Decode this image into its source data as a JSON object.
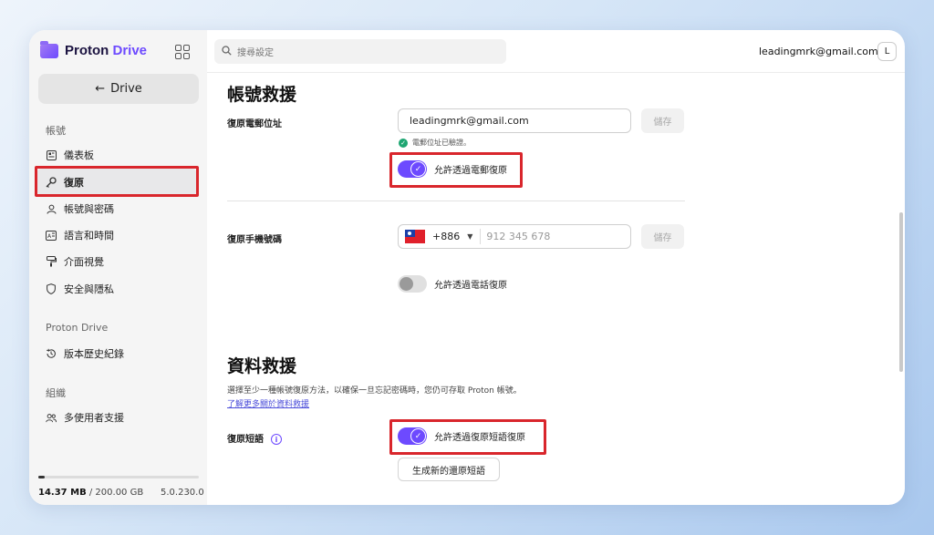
{
  "app": {
    "name_part1": "Proton",
    "name_part2": "Drive"
  },
  "sidebar": {
    "back_label": "Drive",
    "sections": [
      {
        "title": "帳號",
        "items": [
          "儀表板",
          "復原",
          "帳號與密碼",
          "語言和時間",
          "介面視覺",
          "安全與隱私"
        ]
      },
      {
        "title": "Proton Drive",
        "items": [
          "版本歷史紀錄"
        ]
      },
      {
        "title": "組織",
        "items": [
          "多使用者支援"
        ]
      }
    ],
    "active_item": "復原",
    "storage": {
      "used": "14.37 MB",
      "separator": " / ",
      "total": "200.00 GB",
      "used_fraction": 0.04
    },
    "version": "5.0.230.0"
  },
  "header": {
    "search_placeholder": "搜尋設定",
    "user_email": "leadingmrk@gmail.com",
    "avatar_letter": "L"
  },
  "account_recovery": {
    "title": "帳號救援",
    "email": {
      "label": "復原電郵位址",
      "value": "leadingmrk@gmail.com",
      "save_label": "儲存",
      "verified_text": "電郵位址已驗證。",
      "toggle_label": "允許透過電郵復原",
      "toggle_on": true
    },
    "phone": {
      "label": "復原手機號碼",
      "country_code": "+886",
      "placeholder": "912 345 678",
      "save_label": "儲存",
      "toggle_label": "允許透過電話復原",
      "toggle_on": false
    }
  },
  "data_recovery": {
    "title": "資料救援",
    "description": "選擇至少一種帳號復原方法，以確保一旦忘記密碼時，您仍可存取 Proton 帳號。",
    "learn_more": "了解更多關於資料救援",
    "phrase": {
      "label": "復原短語",
      "info_icon": "i",
      "toggle_label": "允許透過復原短語復原",
      "toggle_on": true,
      "generate_label": "生成新的還原短語"
    }
  },
  "colors": {
    "accent": "#6d4aff",
    "highlight": "#d9262c",
    "verified": "#1ea672"
  }
}
